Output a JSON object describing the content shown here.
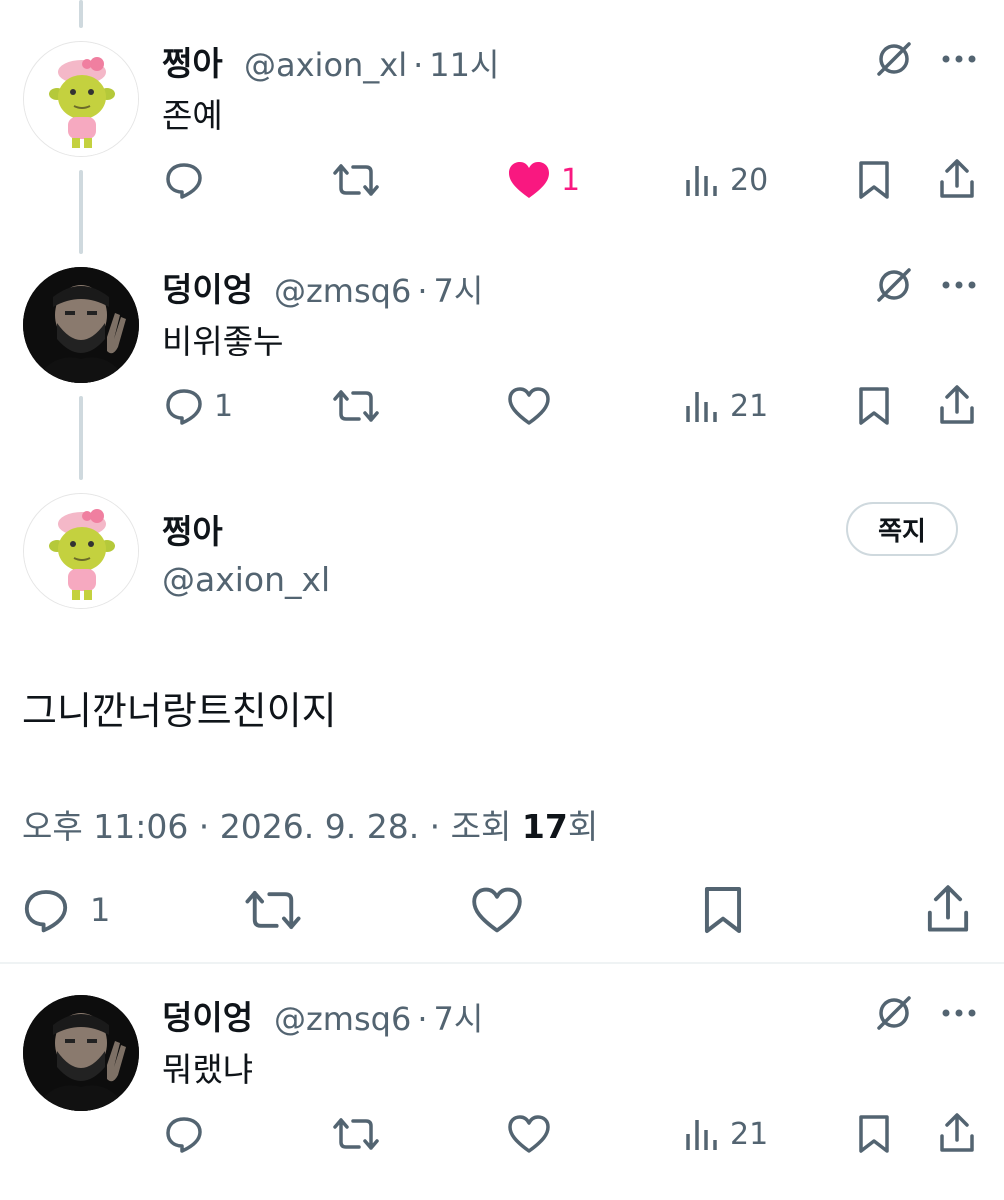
{
  "replies": [
    {
      "name": "쩡아",
      "handle": "@axion_xl",
      "dot": "·",
      "time": "11시",
      "text": "존예",
      "reply_count": "",
      "like_count": "1",
      "liked": true,
      "view_count": "20"
    },
    {
      "name": "덩이엉",
      "handle": "@zmsq6",
      "dot": "·",
      "time": "7시",
      "text": "비위좋누",
      "reply_count": "1",
      "like_count": "",
      "liked": false,
      "view_count": "21"
    }
  ],
  "main_post": {
    "name": "쩡아",
    "handle": "@axion_xl",
    "dm_label": "쪽지",
    "text": "그니깐너랑트친이지",
    "time_text": "오후 11:06 · 2026. 9. 28. · 조회 ",
    "views_number": "17",
    "views_suffix": "회",
    "reply_count": "1"
  },
  "bottom_reply": {
    "name": "덩이엉",
    "handle": "@zmsq6",
    "dot": "·",
    "time": "7시",
    "text": "뭐랬냐",
    "view_count": "21"
  },
  "colors": {
    "text": "#0f1419",
    "secondary": "#536471",
    "like_pink": "#f91880",
    "border": "#cfd9de"
  },
  "icons": [
    "grok-icon",
    "more-icon",
    "reply-icon",
    "retweet-icon",
    "like-icon",
    "views-icon",
    "bookmark-icon",
    "share-icon"
  ]
}
